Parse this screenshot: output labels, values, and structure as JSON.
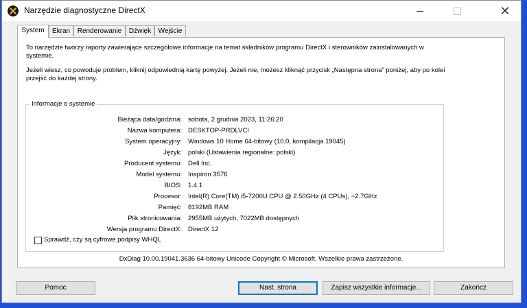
{
  "window": {
    "title": "Narzędzie diagnostyczne DirectX",
    "icon": "directx-icon"
  },
  "tabs": [
    {
      "label": "System",
      "active": true
    },
    {
      "label": "Ekran",
      "active": false
    },
    {
      "label": "Renderowanie",
      "active": false
    },
    {
      "label": "Dźwięk",
      "active": false
    },
    {
      "label": "Wejście",
      "active": false
    }
  ],
  "intro": {
    "p1": "To narzędzie tworzy raporty zawierające szczegółowe informacje na temat składników programu DirectX i sterowników zainstalowanych w systemie.",
    "p2": "Jeżeli wiesz, co powoduje problem, kliknij odpowiednią kartę powyżej. Jeżeli nie, możesz kliknąć przycisk „Następna strona” poniżej, aby po kolei przejść do każdej strony."
  },
  "system_info": {
    "group_label": "Informacje o systemie",
    "rows": [
      {
        "label": "Bieżąca data/godzina:",
        "value": "sobota, 2 grudnia 2023, 11:26:20"
      },
      {
        "label": "Nazwa komputera:",
        "value": "DESKTOP-PRDLVCI"
      },
      {
        "label": "System operacyjny:",
        "value": "Windows 10 Home 64-bitowy (10.0, kompilacja 19045)"
      },
      {
        "label": "Język:",
        "value": "polski (Ustawienia regionalne: polski)"
      },
      {
        "label": "Producent systemu:",
        "value": "Dell Inc."
      },
      {
        "label": "Model systemu:",
        "value": "Inspiron 3576"
      },
      {
        "label": "BIOS:",
        "value": "1.4.1"
      },
      {
        "label": "Procesor:",
        "value": "Intel(R) Core(TM) i5-7200U CPU @ 2.50GHz (4 CPUs), ~2.7GHz"
      },
      {
        "label": "Pamięć:",
        "value": "8192MB RAM"
      },
      {
        "label": "Plik stronicowania:",
        "value": "2955MB użytych, 7022MB dostępnych"
      },
      {
        "label": "Wersja programu DirectX:",
        "value": "DirectX 12"
      }
    ]
  },
  "whql_checkbox": {
    "label": "Sprawdź, czy są cyfrowe podpisy WHQL",
    "checked": false
  },
  "copyright": "DxDiag 10.00.19041.3636 64-bitowy Unicode  Copyright © Microsoft. Wszelkie prawa zastrzeżone.",
  "buttons": {
    "help": "Pomoc",
    "next": "Nast. strona",
    "save": "Zapisz wszystkie informacje...",
    "exit": "Zakończ"
  }
}
